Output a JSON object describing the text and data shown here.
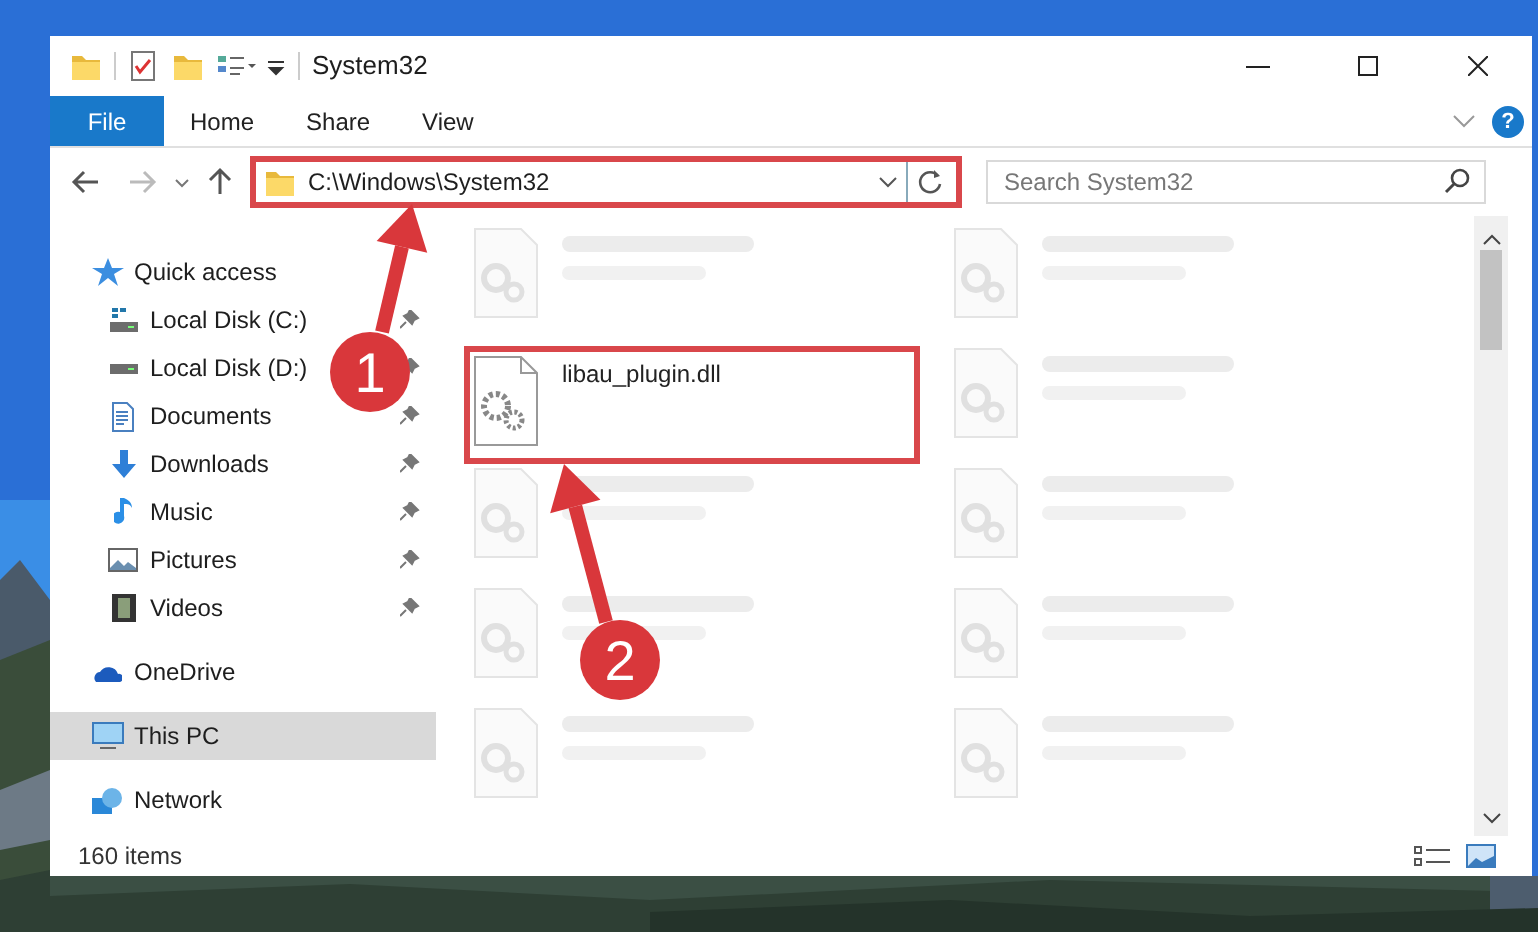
{
  "window": {
    "title": "System32"
  },
  "ribbon": {
    "tabs": [
      {
        "label": "File",
        "selected": true
      },
      {
        "label": "Home",
        "selected": false
      },
      {
        "label": "Share",
        "selected": false
      },
      {
        "label": "View",
        "selected": false
      }
    ],
    "help": "?"
  },
  "address_bar": {
    "path": "C:\\Windows\\System32",
    "highlighted": true
  },
  "search": {
    "placeholder": "Search System32"
  },
  "sidebar": {
    "items": [
      {
        "label": "Quick access",
        "kind": "quick",
        "selected": false,
        "children": [
          {
            "label": "Local Disk (C:)",
            "kind": "diskc",
            "selected": false,
            "pinned": true
          },
          {
            "label": "Local Disk (D:)",
            "kind": "disk",
            "selected": false,
            "pinned": true
          },
          {
            "label": "Documents",
            "kind": "documents",
            "selected": false,
            "pinned": true
          },
          {
            "label": "Downloads",
            "kind": "downloads",
            "selected": false,
            "pinned": true
          },
          {
            "label": "Music",
            "kind": "music",
            "selected": false,
            "pinned": true
          },
          {
            "label": "Pictures",
            "kind": "pictures",
            "selected": false,
            "pinned": true
          },
          {
            "label": "Videos",
            "kind": "videos",
            "selected": false,
            "pinned": true
          }
        ]
      },
      {
        "label": "OneDrive",
        "kind": "cloud",
        "selected": false
      },
      {
        "label": "This PC",
        "kind": "pc",
        "selected": true
      },
      {
        "label": "Network",
        "kind": "network",
        "selected": false
      }
    ]
  },
  "files": [
    {
      "kind": "blurred"
    },
    {
      "kind": "blurred"
    },
    {
      "kind": "file",
      "name": "libau_plugin.dll",
      "highlighted": true
    },
    {
      "kind": "blurred"
    },
    {
      "kind": "blurred"
    },
    {
      "kind": "blurred"
    },
    {
      "kind": "blurred"
    },
    {
      "kind": "blurred"
    },
    {
      "kind": "blurred"
    },
    {
      "kind": "blurred"
    }
  ],
  "status_bar": {
    "item_count": "160 items"
  },
  "annotations": [
    {
      "label": "1"
    },
    {
      "label": "2"
    }
  ]
}
